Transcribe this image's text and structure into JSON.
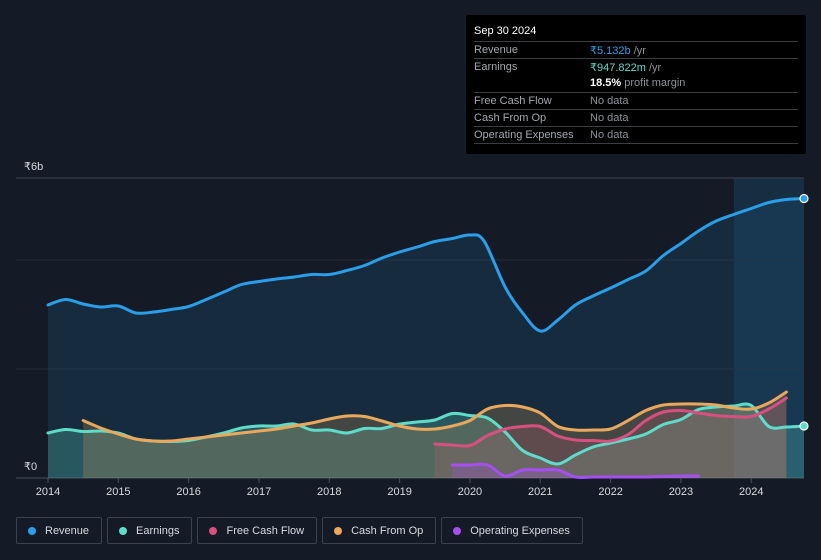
{
  "tooltip": {
    "date": "Sep 30 2024",
    "rows": [
      {
        "label": "Revenue",
        "value": "₹5.132b",
        "suffix": " /yr"
      },
      {
        "label": "Earnings",
        "value": "₹947.822m",
        "suffix": " /yr"
      },
      {
        "label": "",
        "value": "18.5%",
        "suffix": " profit margin"
      },
      {
        "label": "Free Cash Flow",
        "value": "No data"
      },
      {
        "label": "Cash From Op",
        "value": "No data"
      },
      {
        "label": "Operating Expenses",
        "value": "No data"
      }
    ]
  },
  "legend": [
    {
      "label": "Revenue",
      "color": "#2a9ee8"
    },
    {
      "label": "Earnings",
      "color": "#5fdcc9"
    },
    {
      "label": "Free Cash Flow",
      "color": "#d8507f"
    },
    {
      "label": "Cash From Op",
      "color": "#e9a85b"
    },
    {
      "label": "Operating Expenses",
      "color": "#a64ff0"
    }
  ],
  "chart_data": {
    "type": "line",
    "title": "",
    "xlabel": "",
    "ylabel": "",
    "y_unit": "₹b",
    "ylim": [
      0,
      6
    ],
    "y_tick_labels": [
      "₹0",
      "₹6b"
    ],
    "x_tick_labels": [
      "2014",
      "2015",
      "2016",
      "2017",
      "2018",
      "2019",
      "2020",
      "2021",
      "2022",
      "2023",
      "2024"
    ],
    "xlim": [
      2014,
      2024.75
    ],
    "forecast_shade_from": 2023.75,
    "grid": true,
    "series": [
      {
        "name": "Revenue",
        "color": "#2a9ee8",
        "fill": true,
        "x": [
          2014,
          2014.25,
          2014.5,
          2014.75,
          2015,
          2015.25,
          2015.5,
          2015.75,
          2016,
          2016.25,
          2016.5,
          2016.75,
          2017,
          2017.25,
          2017.5,
          2017.75,
          2018,
          2018.25,
          2018.5,
          2018.75,
          2019,
          2019.25,
          2019.5,
          2019.75,
          2020,
          2020.2,
          2020.5,
          2020.75,
          2021,
          2021.25,
          2021.5,
          2021.75,
          2022,
          2022.25,
          2022.5,
          2022.75,
          2023,
          2023.25,
          2023.5,
          2023.75,
          2024,
          2024.25,
          2024.5,
          2024.75
        ],
        "y": [
          3.46,
          3.57,
          3.48,
          3.42,
          3.44,
          3.3,
          3.32,
          3.37,
          3.43,
          3.57,
          3.72,
          3.87,
          3.93,
          3.98,
          4.02,
          4.07,
          4.07,
          4.15,
          4.25,
          4.4,
          4.52,
          4.62,
          4.73,
          4.79,
          4.86,
          4.74,
          3.82,
          3.3,
          2.94,
          3.16,
          3.46,
          3.64,
          3.8,
          3.97,
          4.14,
          4.45,
          4.69,
          4.94,
          5.14,
          5.27,
          5.39,
          5.51,
          5.57,
          5.59
        ]
      },
      {
        "name": "Earnings",
        "color": "#5fdcc9",
        "fill": true,
        "x": [
          2014,
          2014.25,
          2014.5,
          2014.75,
          2015,
          2015.25,
          2015.5,
          2015.75,
          2016,
          2016.25,
          2016.5,
          2016.75,
          2017,
          2017.25,
          2017.5,
          2017.75,
          2018,
          2018.25,
          2018.5,
          2018.75,
          2019,
          2019.25,
          2019.5,
          2019.75,
          2020,
          2020.25,
          2020.5,
          2020.75,
          2021,
          2021.25,
          2021.5,
          2021.75,
          2022,
          2022.25,
          2022.5,
          2022.75,
          2023,
          2023.25,
          2023.5,
          2023.75,
          2024,
          2024.25,
          2024.5,
          2024.75
        ],
        "y": [
          0.9,
          0.97,
          0.93,
          0.94,
          0.9,
          0.78,
          0.74,
          0.73,
          0.75,
          0.82,
          0.9,
          1.0,
          1.04,
          1.04,
          1.08,
          0.96,
          0.96,
          0.9,
          0.99,
          0.99,
          1.08,
          1.12,
          1.16,
          1.29,
          1.25,
          1.2,
          0.92,
          0.55,
          0.4,
          0.28,
          0.46,
          0.62,
          0.7,
          0.78,
          0.88,
          1.07,
          1.17,
          1.37,
          1.42,
          1.44,
          1.45,
          1.03,
          1.02,
          1.04
        ]
      },
      {
        "name": "Free Cash Flow",
        "color": "#d8507f",
        "fill": true,
        "x": [
          2019.5,
          2019.75,
          2020,
          2020.25,
          2020.5,
          2020.75,
          2021,
          2021.25,
          2021.5,
          2021.75,
          2022,
          2022.25,
          2022.5,
          2022.75,
          2023,
          2023.25,
          2023.5,
          2023.75,
          2024,
          2024.25,
          2024.5
        ],
        "y": [
          0.68,
          0.66,
          0.65,
          0.85,
          0.98,
          1.03,
          1.03,
          0.84,
          0.76,
          0.75,
          0.74,
          0.87,
          1.15,
          1.32,
          1.35,
          1.3,
          1.25,
          1.23,
          1.23,
          1.38,
          1.6
        ]
      },
      {
        "name": "Cash From Op",
        "color": "#e9a85b",
        "fill": true,
        "x": [
          2014.5,
          2014.75,
          2015,
          2015.25,
          2015.5,
          2015.75,
          2016,
          2016.25,
          2016.5,
          2016.75,
          2017,
          2017.25,
          2017.5,
          2017.75,
          2018,
          2018.25,
          2018.5,
          2018.75,
          2019,
          2019.25,
          2019.5,
          2019.75,
          2020,
          2020.25,
          2020.5,
          2020.75,
          2021,
          2021.25,
          2021.5,
          2021.75,
          2022,
          2022.25,
          2022.5,
          2022.75,
          2023,
          2023.25,
          2023.5,
          2023.75,
          2024,
          2024.25,
          2024.5
        ],
        "y": [
          1.15,
          1.0,
          0.88,
          0.78,
          0.74,
          0.74,
          0.78,
          0.82,
          0.86,
          0.9,
          0.94,
          0.98,
          1.04,
          1.1,
          1.18,
          1.24,
          1.23,
          1.14,
          1.04,
          0.98,
          0.98,
          1.04,
          1.15,
          1.38,
          1.45,
          1.42,
          1.3,
          1.03,
          0.96,
          0.96,
          0.98,
          1.15,
          1.35,
          1.46,
          1.48,
          1.48,
          1.46,
          1.4,
          1.38,
          1.5,
          1.72
        ]
      },
      {
        "name": "Operating Expenses",
        "color": "#a64ff0",
        "fill": true,
        "x": [
          2019.75,
          2020,
          2020.25,
          2020.5,
          2020.75,
          2021,
          2021.25,
          2021.5,
          2021.75,
          2022,
          2022.25,
          2022.5,
          2022.75,
          2023,
          2023.25
        ],
        "y": [
          0.26,
          0.26,
          0.26,
          0.04,
          0.16,
          0.16,
          0.16,
          0.02,
          0.02,
          0.02,
          0.02,
          0.02,
          0.03,
          0.04,
          0.04
        ]
      }
    ]
  }
}
